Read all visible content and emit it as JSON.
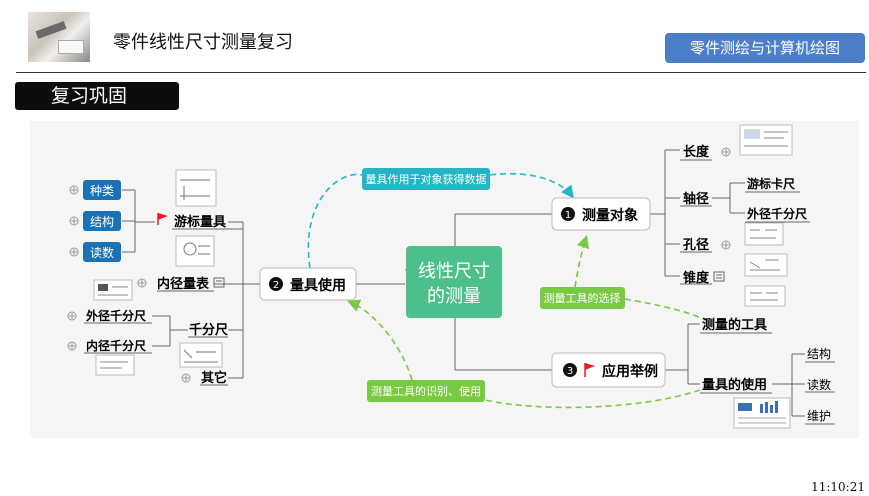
{
  "header": {
    "title": "零件线性尺寸测量复习",
    "course": "零件测绘与计算机绘图",
    "section": "复习巩固"
  },
  "mindmap": {
    "central": [
      "线性尺寸",
      "的测量"
    ],
    "node_object": "测量对象",
    "node_object_num": "1",
    "node_usage": "量具使用",
    "node_usage_num": "2",
    "node_example": "应用举例",
    "node_example_num": "3",
    "object_children": {
      "length": "长度",
      "shaft": "轴径",
      "hole": "孔径",
      "taper": "锥度"
    },
    "shaft_children": {
      "vernier": "游标卡尺",
      "micrometer": "外径千分尺"
    },
    "usage_children": {
      "vernier_tool": "游标量具",
      "bore_gauge": "内径量表",
      "micrometer_group": "千分尺",
      "other": "其它"
    },
    "vernier_children": {
      "kind": "种类",
      "structure": "结构",
      "reading": "读数"
    },
    "micrometer_children": {
      "outer": "外径千分尺",
      "inner": "内径千分尺"
    },
    "example_children": {
      "tools": "测量的工具",
      "use": "量具的使用"
    },
    "use_children": {
      "structure": "结构",
      "reading": "读数",
      "maintenance": "维护"
    },
    "relations": {
      "tool_to_object": "量具作用于对象获得数据",
      "object_tool_choice": "测量工具的选择",
      "example_to_usage": "测量工具的识别、使用"
    }
  },
  "colors": {
    "central": "#4dbf8a",
    "blue_badge": "#4c7fc8",
    "teal_label": "#26b5c4",
    "green_label": "#7ac943",
    "leaf_blue": "#1a72b5",
    "flag_red": "#e02020"
  },
  "footer": {
    "time": "11:10:21"
  }
}
